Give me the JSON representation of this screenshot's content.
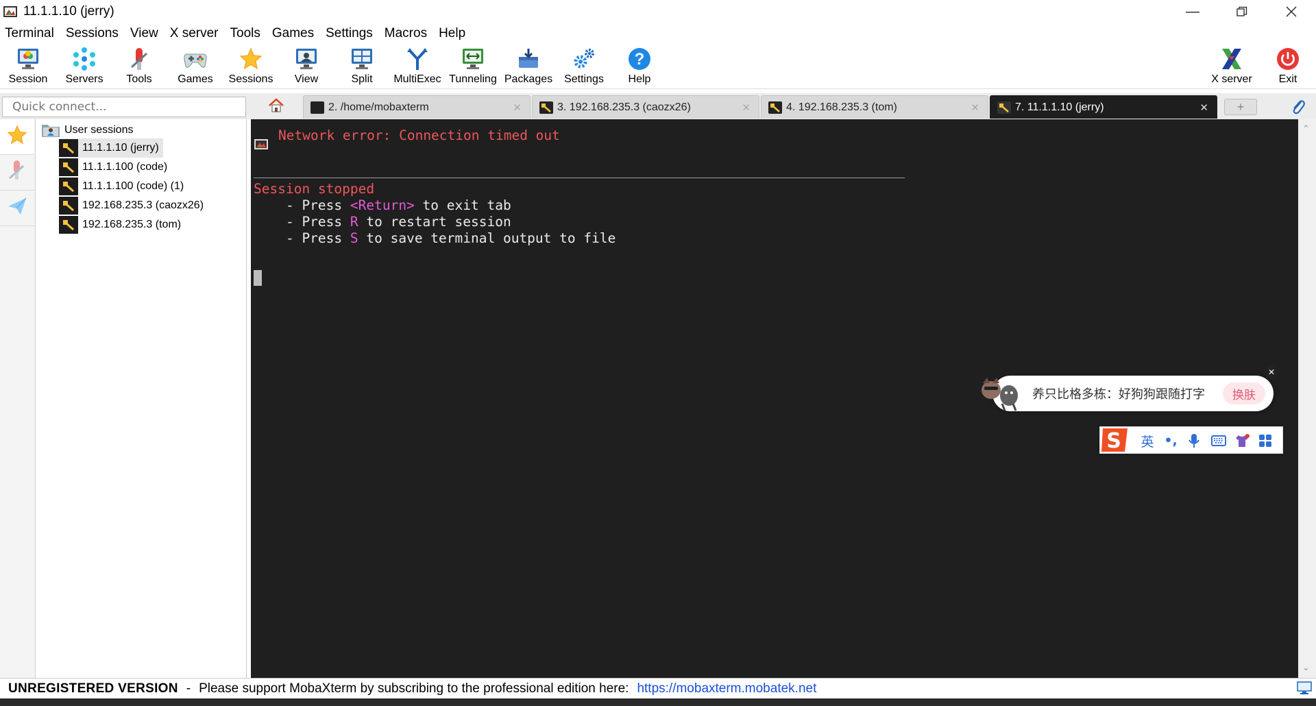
{
  "window": {
    "title": "11.1.1.10 (jerry)",
    "minimize_icon": "minimize-icon",
    "maximize_icon": "restore-icon",
    "close_icon": "close-icon"
  },
  "menu": [
    "Terminal",
    "Sessions",
    "View",
    "X server",
    "Tools",
    "Games",
    "Settings",
    "Macros",
    "Help"
  ],
  "toolbar": {
    "session": "Session",
    "servers": "Servers",
    "tools": "Tools",
    "games": "Games",
    "sessions": "Sessions",
    "view": "View",
    "split": "Split",
    "multiexec": "MultiExec",
    "tunneling": "Tunneling",
    "packages": "Packages",
    "settings": "Settings",
    "help": "Help",
    "xserver": "X server",
    "exit": "Exit"
  },
  "quick_connect": {
    "placeholder": "Quick connect..."
  },
  "tabs": [
    {
      "label": "2. /home/mobaxterm",
      "icon": "terminal-icon"
    },
    {
      "label": "3. 192.168.235.3 (caozx26)",
      "icon": "ssh-key-icon"
    },
    {
      "label": "4. 192.168.235.3 (tom)",
      "icon": "ssh-key-icon"
    },
    {
      "label": "7. 11.1.1.10 (jerry)",
      "icon": "ssh-key-icon",
      "active": true
    }
  ],
  "sessions_tree": {
    "root": "User sessions",
    "items": [
      "11.1.1.10 (jerry)",
      "11.1.1.100 (code)",
      "11.1.1.100 (code) (1)",
      "192.168.235.3 (caozx26)",
      "192.168.235.3 (tom)"
    ]
  },
  "terminal": {
    "error": "Network error: Connection timed out",
    "stopped": "Session stopped",
    "line1_pre": "    - Press ",
    "line1_key": "<Return>",
    "line1_post": " to exit tab",
    "line2_pre": "    - Press ",
    "line2_key": "R",
    "line2_post": " to restart session",
    "line3_pre": "    - Press ",
    "line3_key": "S",
    "line3_post": " to save terminal output to file"
  },
  "ime_popup": {
    "text": "养只比格多栋：好狗狗跟随打字",
    "button": "换肤",
    "lang": "英",
    "punct": "•,"
  },
  "status": {
    "unregistered": "UNREGISTERED VERSION",
    "separator": "-",
    "message": "Please support MobaXterm by subscribing to the professional edition here:",
    "link": "https://mobaxterm.mobatek.net"
  },
  "colors": {
    "terminal_bg": "#1f1f1f",
    "error_red": "#f0565b",
    "key_magenta": "#e45ad8",
    "link_blue": "#1a4ed8"
  }
}
